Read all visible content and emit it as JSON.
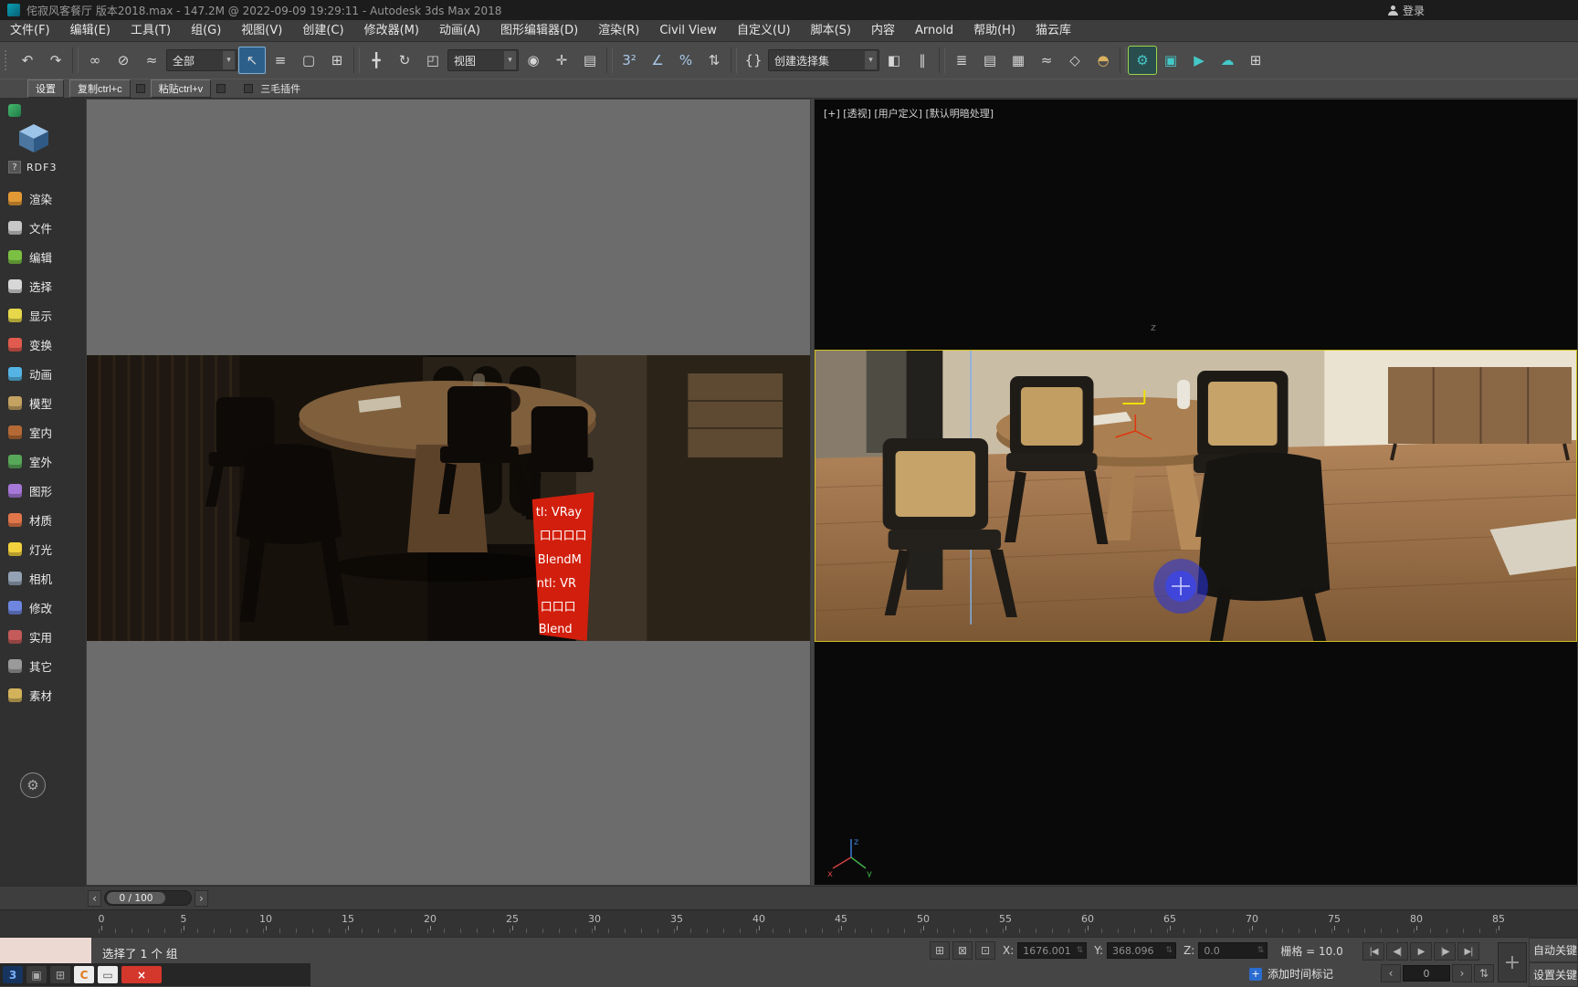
{
  "title_bar": {
    "app_title": "侘寂风客餐厅 版本2018.max - 147.2M @ 2022-09-09 19:29:11 - Autodesk 3ds Max 2018",
    "login_label": "登录"
  },
  "menu": {
    "items": [
      {
        "n": "menu-file",
        "label": "文件(F)"
      },
      {
        "n": "menu-edit",
        "label": "编辑(E)"
      },
      {
        "n": "menu-tools",
        "label": "工具(T)"
      },
      {
        "n": "menu-group",
        "label": "组(G)"
      },
      {
        "n": "menu-views",
        "label": "视图(V)"
      },
      {
        "n": "menu-create",
        "label": "创建(C)"
      },
      {
        "n": "menu-modifiers",
        "label": "修改器(M)"
      },
      {
        "n": "menu-animation",
        "label": "动画(A)"
      },
      {
        "n": "menu-graph-editors",
        "label": "图形编辑器(D)"
      },
      {
        "n": "menu-rendering",
        "label": "渲染(R)"
      },
      {
        "n": "menu-civil-view",
        "label": "Civil View"
      },
      {
        "n": "menu-customize",
        "label": "自定义(U)"
      },
      {
        "n": "menu-scripting",
        "label": "脚本(S)"
      },
      {
        "n": "menu-content",
        "label": "内容"
      },
      {
        "n": "menu-arnold",
        "label": "Arnold"
      },
      {
        "n": "menu-help",
        "label": "帮助(H)"
      },
      {
        "n": "menu-maoyunku",
        "label": "猫云库"
      }
    ]
  },
  "toolbar": {
    "items": [
      {
        "n": "undo-icon",
        "g": "↶"
      },
      {
        "n": "redo-icon",
        "g": "↷"
      },
      {
        "cls": "sep"
      },
      {
        "n": "select-and-link-icon",
        "g": "∞"
      },
      {
        "n": "unlink-selection-icon",
        "g": "⊘"
      },
      {
        "n": "bind-to-spacewarp-icon",
        "g": "≈"
      },
      {
        "n": "selection-filter-dropdown",
        "g": "全部",
        "cls": "dd"
      },
      {
        "n": "select-object-icon",
        "g": "↖",
        "cls": "active"
      },
      {
        "n": "select-by-name-icon",
        "g": "≡"
      },
      {
        "n": "selection-region-icon",
        "g": "▢"
      },
      {
        "n": "window-crossing-icon",
        "g": "⊞"
      },
      {
        "cls": "sep"
      },
      {
        "n": "select-and-move-icon",
        "g": "╋"
      },
      {
        "n": "select-and-rotate-icon",
        "g": "↻"
      },
      {
        "n": "select-and-scale-icon",
        "g": "◰"
      },
      {
        "n": "reference-coordinate-dropdown",
        "g": "视图",
        "cls": "dd"
      },
      {
        "n": "use-pivot-center-icon",
        "g": "◉"
      },
      {
        "n": "select-and-manipulate-icon",
        "g": "✛"
      },
      {
        "n": "keyboard-override-icon",
        "g": "▤"
      },
      {
        "cls": "sep"
      },
      {
        "n": "snap-toggle-3d-icon",
        "g": "3²",
        "cls": "blue"
      },
      {
        "n": "angle-snap-icon",
        "g": "∠",
        "cls": "blue"
      },
      {
        "n": "percent-snap-icon",
        "g": "%",
        "cls": "blue"
      },
      {
        "n": "spinner-snap-icon",
        "g": "⇅"
      },
      {
        "cls": "sep"
      },
      {
        "n": "edit-named-sets-icon",
        "g": "{}"
      },
      {
        "n": "named-selection-sets-dropdown",
        "g": "创建选择集",
        "cls": "dd wide"
      },
      {
        "n": "mirror-icon",
        "g": "◧"
      },
      {
        "n": "align-icon",
        "g": "∥"
      },
      {
        "cls": "sep"
      },
      {
        "n": "layer-explorer-icon",
        "g": "≣"
      },
      {
        "n": "scene-explorer-icon",
        "g": "▤"
      },
      {
        "n": "ribbon-toggle-icon",
        "g": "▦"
      },
      {
        "n": "curve-editor-icon",
        "g": "≈"
      },
      {
        "n": "schematic-view-icon",
        "g": "◇"
      },
      {
        "n": "material-editor-icon",
        "g": "◓",
        "cls": "warm"
      },
      {
        "cls": "sep"
      },
      {
        "n": "render-setup-icon",
        "g": "⚙",
        "cls": "teal hl"
      },
      {
        "n": "rendered-frame-icon",
        "g": "▣",
        "cls": "teal"
      },
      {
        "n": "render-production-icon",
        "g": "▶",
        "cls": "teal"
      },
      {
        "n": "render-cloud-icon",
        "g": "☁",
        "cls": "teal"
      },
      {
        "n": "workspace-grid-icon",
        "g": "⊞"
      }
    ]
  },
  "plugin_bar": {
    "settings": "设置",
    "copy": "复制ctrl+c",
    "paste": "粘贴ctrl+v",
    "plugin_label": "三毛插件"
  },
  "sidebar": {
    "brand": "RDF3",
    "help": "?",
    "items": [
      {
        "n": "sidebar-item-render",
        "label": "渲染",
        "color": "#e39a35"
      },
      {
        "n": "sidebar-item-file",
        "label": "文件",
        "color": "#c8c8c8"
      },
      {
        "n": "sidebar-item-edit",
        "label": "编辑",
        "color": "#7bc043"
      },
      {
        "n": "sidebar-item-select",
        "label": "选择",
        "color": "#d7d7d7"
      },
      {
        "n": "sidebar-item-display",
        "label": "显示",
        "color": "#e6d84a"
      },
      {
        "n": "sidebar-item-transform",
        "label": "变换",
        "color": "#e05a4e"
      },
      {
        "n": "sidebar-item-animation",
        "label": "动画",
        "color": "#55b4e5"
      },
      {
        "n": "sidebar-item-model",
        "label": "模型",
        "color": "#c3a262"
      },
      {
        "n": "sidebar-item-interior",
        "label": "室内",
        "color": "#b56a36"
      },
      {
        "n": "sidebar-item-exterior",
        "label": "室外",
        "color": "#58a85a"
      },
      {
        "n": "sidebar-item-shapes",
        "label": "图形",
        "color": "#a678d8"
      },
      {
        "n": "sidebar-item-material",
        "label": "材质",
        "color": "#e0764a"
      },
      {
        "n": "sidebar-item-light",
        "label": "灯光",
        "color": "#f2d23c"
      },
      {
        "n": "sidebar-item-camera",
        "label": "相机",
        "color": "#93a2b4"
      },
      {
        "n": "sidebar-item-modify",
        "label": "修改",
        "color": "#6e86e0"
      },
      {
        "n": "sidebar-item-utility",
        "label": "实用",
        "color": "#c45a5a"
      },
      {
        "n": "sidebar-item-other",
        "label": "其它",
        "color": "#9a9a9a"
      },
      {
        "n": "sidebar-item-assets",
        "label": "素材",
        "color": "#d2b25a"
      }
    ]
  },
  "viewports": {
    "right_label": "[+] [透视] [用户定义] [默认明暗处理]",
    "axis_x": "x",
    "axis_y": "y",
    "axis_z": "z",
    "world_z": "z"
  },
  "scene_overlay": {
    "lines": [
      "tl: VRay",
      "口口口口",
      "BlendM",
      "ntl: VR",
      "口口口",
      "Blend"
    ]
  },
  "timeline": {
    "slider_label": "0 / 100",
    "ticks": [
      "0",
      "5",
      "10",
      "15",
      "20",
      "25",
      "30",
      "35",
      "40",
      "45",
      "50",
      "55",
      "60",
      "65",
      "70",
      "75",
      "80",
      "85"
    ]
  },
  "status_bar": {
    "selection_status": "选择了 1 个 组",
    "x_label": "X:",
    "x_value": "1676.001",
    "y_label": "Y:",
    "y_value": "368.096",
    "z_label": "Z:",
    "z_value": "0.0",
    "grid_label": "栅格 = 10.0",
    "auto_key": "自动关键点",
    "set_key": "设置关键点",
    "add_time_tag": "添加时间标记",
    "frame_value": "0"
  },
  "playback": {
    "items": [
      {
        "n": "go-to-start-button",
        "g": "|◀"
      },
      {
        "n": "prev-frame-button",
        "g": "◀|"
      },
      {
        "n": "play-button",
        "g": "▶"
      },
      {
        "n": "next-frame-button",
        "g": "|▶"
      },
      {
        "n": "go-to-end-button",
        "g": "▶|"
      }
    ]
  },
  "status_icons": {
    "items": [
      {
        "n": "transform-type-in-icon",
        "g": "⊞"
      },
      {
        "n": "lock-selection-icon",
        "g": "⊠"
      },
      {
        "n": "absolute-relative-icon",
        "g": "⊡"
      }
    ]
  },
  "taskbar": {
    "items": [
      {
        "n": "taskbar-3dsmax-icon",
        "g": "3",
        "color": "#7ab0ff",
        "cls": "blue3"
      },
      {
        "n": "taskbar-app-icon",
        "g": "▣",
        "color": "#aaa"
      },
      {
        "n": "taskbar-grid-icon",
        "g": "⊞",
        "color": "#999"
      },
      {
        "n": "taskbar-browser-icon",
        "g": "C",
        "color": "#e07a20",
        "cls": "lightbg"
      },
      {
        "n": "taskbar-window-icon",
        "g": "▭",
        "color": "#555",
        "cls": "lightbg"
      },
      {
        "n": "taskbar-close-icon",
        "g": "×",
        "cls": "red"
      }
    ]
  },
  "icons": {
    "dropdown_arrow": "▾",
    "slider_prev": "‹",
    "slider_next": "›",
    "spinner": "⇅",
    "gear": "⚙",
    "big_plus": "+",
    "tag_plus": "+"
  },
  "colors": {
    "active_viewport_border": "#d2c01c",
    "selection_highlight_blue": "#2d5f8b",
    "banner_red": "#d21f0d",
    "brush_cursor_blue": "#2733e0"
  }
}
